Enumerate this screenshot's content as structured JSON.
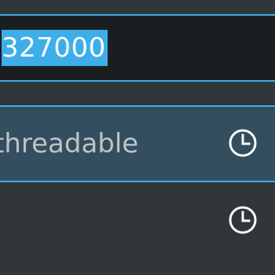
{
  "search": {
    "value": "327000",
    "selected": true
  },
  "results": [
    {
      "label": "threadable",
      "icon": "clock-icon",
      "selected": true
    },
    {
      "label": "",
      "icon": "clock-icon",
      "selected": false
    }
  ],
  "colors": {
    "background": "#31363b",
    "accent": "#3daee9",
    "input_background": "#1b1e20",
    "selected_row": "#334e5e",
    "text": "#bdc3c7",
    "highlight_text": "#fcfcfc",
    "icon": "#fcfcfc"
  }
}
